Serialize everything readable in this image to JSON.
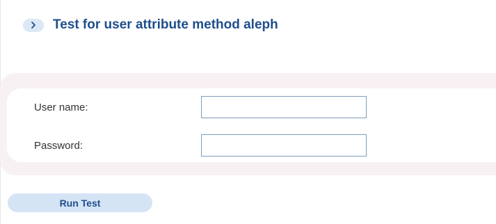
{
  "header": {
    "icon": "chevron-right-icon",
    "title": "Test for user attribute method aleph"
  },
  "form": {
    "username_label": "User name:",
    "username_value": "",
    "password_label": "Password:",
    "password_value": ""
  },
  "actions": {
    "run_test_label": "Run Test"
  },
  "colors": {
    "accent": "#1e4e8c",
    "badge_bg": "#dce8f5",
    "form_bg": "#f8f1f4",
    "button_bg": "#d4e4f5"
  }
}
